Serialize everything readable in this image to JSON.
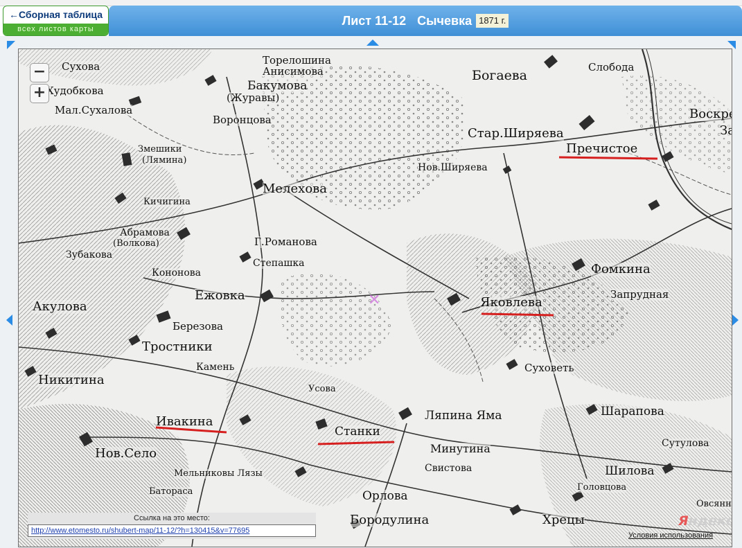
{
  "header": {
    "sheet": "Лист 11-12",
    "place": "Сычевка",
    "year": "1871 г."
  },
  "summary_button": {
    "line1": "←Сборная таблица",
    "line2": "всех листов карты"
  },
  "map": {
    "labels": [
      {
        "id": "torelovshchina",
        "text": "Торелошина"
      },
      {
        "id": "anisimova",
        "text": "Анисимова"
      },
      {
        "id": "bakumova",
        "text": "Бакумова"
      },
      {
        "id": "zhuravy",
        "text": "(Журавы)"
      },
      {
        "id": "suhova",
        "text": "Сухова"
      },
      {
        "id": "hudobkova",
        "text": "Худобкова"
      },
      {
        "id": "malsuhalova",
        "text": "Мал.Сухалова"
      },
      {
        "id": "vorontsova",
        "text": "Воронцова"
      },
      {
        "id": "bogaeva",
        "text": "Богаева"
      },
      {
        "id": "sloboda",
        "text": "Слобода"
      },
      {
        "id": "voskresenskoe",
        "text": "Воскре"
      },
      {
        "id": "zas",
        "text": "Зас"
      },
      {
        "id": "starshiryaeva",
        "text": "Стар.Ширяева"
      },
      {
        "id": "prechistoe",
        "text": "Пречистое"
      },
      {
        "id": "novshiryaeva",
        "text": "Нов.Ширяева"
      },
      {
        "id": "zhelshchiki",
        "text": "Змешики"
      },
      {
        "id": "lyamina",
        "text": "(Лямина)"
      },
      {
        "id": "melekhova",
        "text": "Мелехова"
      },
      {
        "id": "kichigina",
        "text": "Кичигина"
      },
      {
        "id": "abramova",
        "text": "Абрамова"
      },
      {
        "id": "volkova",
        "text": "(Волкова)"
      },
      {
        "id": "romanova",
        "text": "Г.Романова"
      },
      {
        "id": "zubakova",
        "text": "Зубакова"
      },
      {
        "id": "stepashka",
        "text": "Степашка"
      },
      {
        "id": "kononova",
        "text": "Кононова"
      },
      {
        "id": "fomkina",
        "text": "Фомкина"
      },
      {
        "id": "ezhovka",
        "text": "Ежовка"
      },
      {
        "id": "yakovleva",
        "text": "Яковлева"
      },
      {
        "id": "zaprudnaya",
        "text": "Запрудная"
      },
      {
        "id": "akulova",
        "text": "Акулова"
      },
      {
        "id": "berezova",
        "text": "Березова"
      },
      {
        "id": "trostniki",
        "text": "Тростники"
      },
      {
        "id": "kamen",
        "text": "Камень"
      },
      {
        "id": "suhovet",
        "text": "Суховеть"
      },
      {
        "id": "nikitina",
        "text": "Никитина"
      },
      {
        "id": "usova",
        "text": "Усова"
      },
      {
        "id": "lyapina_yama",
        "text": "Ляпина Яма"
      },
      {
        "id": "sharapova",
        "text": "Шарапова"
      },
      {
        "id": "ivakina",
        "text": "Ивакина"
      },
      {
        "id": "stanki",
        "text": "Станки"
      },
      {
        "id": "minutina",
        "text": "Минутина"
      },
      {
        "id": "sutulova",
        "text": "Сутулова"
      },
      {
        "id": "novselo",
        "text": "Нов.Село"
      },
      {
        "id": "svistova",
        "text": "Свистова"
      },
      {
        "id": "shilova",
        "text": "Шилова"
      },
      {
        "id": "melnikovy",
        "text": "Мельниковы Лязы"
      },
      {
        "id": "golovtsova",
        "text": "Головцова"
      },
      {
        "id": "orlova",
        "text": "Орлова"
      },
      {
        "id": "batoras",
        "text": "Батораса"
      },
      {
        "id": "borodulina",
        "text": "Бородулина"
      },
      {
        "id": "khretsy",
        "text": "Хрецы"
      },
      {
        "id": "ovsyannikova",
        "text": "Овсянн"
      }
    ],
    "underline_color": "#d61f1f",
    "zoom_in": "+",
    "zoom_out": "−"
  },
  "link": {
    "label": "Ссылка на это место:",
    "url": "http://www.etomesto.ru/shubert-map/11-12/?h=130415&v=77695"
  },
  "terms": "Условия использования",
  "logo": {
    "y": "Я",
    "rest": "ндекс"
  },
  "colors": {
    "header": "#4a97dc",
    "arrow": "#2b8ce6",
    "summary_green": "#4cae32"
  }
}
